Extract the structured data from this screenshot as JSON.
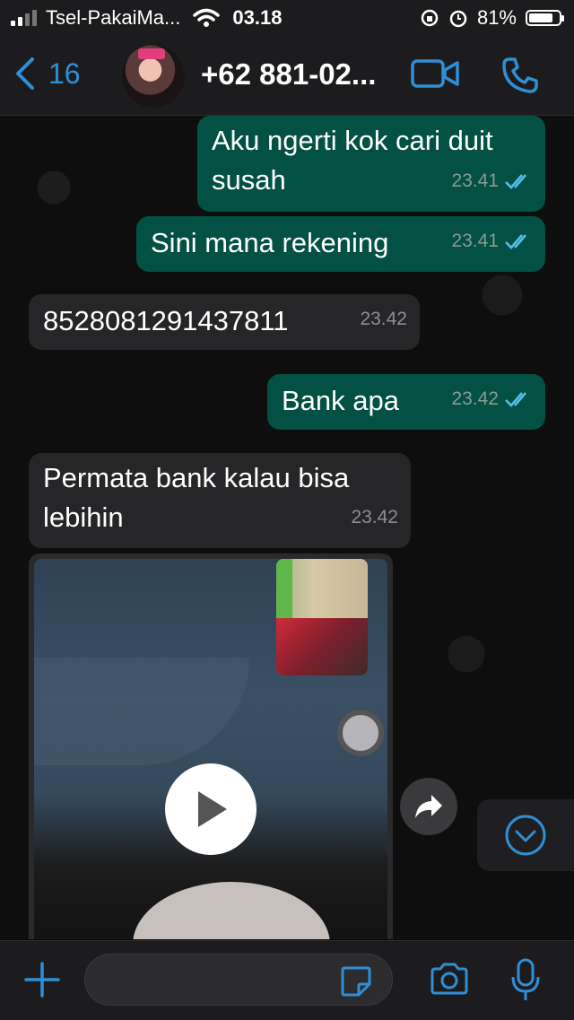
{
  "status_bar": {
    "carrier": "Tsel-PakaiMa...",
    "time": "03.18",
    "battery": "81%",
    "battery_level": 0.81
  },
  "header": {
    "back_count": "16",
    "contact_name": "+62 881-02...",
    "icons": [
      "video-call-icon",
      "voice-call-icon"
    ]
  },
  "messages": [
    {
      "dir": "out",
      "text": "Aku ngerti kok cari duit susah",
      "time": "23.41",
      "status": "read"
    },
    {
      "dir": "out",
      "text": "Sini mana rekening",
      "time": "23.41",
      "status": "read"
    },
    {
      "dir": "in",
      "text": "8528081291437811",
      "time": "23.42"
    },
    {
      "dir": "out",
      "text": "Bank apa",
      "time": "23.42",
      "status": "read"
    },
    {
      "dir": "in",
      "text": "Permata bank kalau bisa lebihin",
      "time": "23.42"
    },
    {
      "dir": "in",
      "type": "video"
    }
  ],
  "composer": {
    "placeholder": "",
    "icons": [
      "plus-icon",
      "sticker-icon",
      "camera-icon",
      "microphone-icon"
    ]
  },
  "colors": {
    "accent": "#2f8fd6",
    "outgoing_bubble": "#025144",
    "incoming_bubble": "#262628",
    "read_ticks": "#53bdeb"
  }
}
